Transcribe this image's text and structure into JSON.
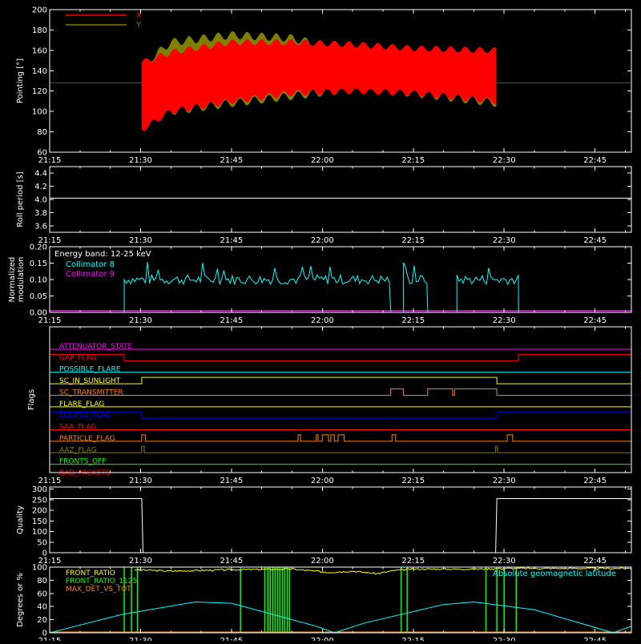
{
  "chart_data": [
    {
      "type": "line",
      "id": "pointing",
      "ylabel": "Pointing [°]",
      "yticks": [
        60,
        80,
        100,
        120,
        140,
        160,
        180,
        200
      ],
      "ylim": [
        60,
        200
      ],
      "xticks": [
        "21:15",
        "21:30",
        "21:45",
        "22:00",
        "22:15",
        "22:30",
        "22:45"
      ],
      "x_range_minutes": [
        0,
        96
      ],
      "legend": "top-left",
      "series": [
        {
          "name": "X",
          "color": "#ff0000",
          "baseline": 128,
          "active": [
            15.2,
            73.8
          ],
          "upper": [
            [
              15.2,
              148
            ],
            [
              20,
              158
            ],
            [
              30,
              168
            ],
            [
              40,
              168
            ],
            [
              50,
              166
            ],
            [
              60,
              162
            ],
            [
              73.8,
              160
            ]
          ],
          "lower": [
            [
              15.2,
              82
            ],
            [
              20,
              100
            ],
            [
              30,
              110
            ],
            [
              40,
              118
            ],
            [
              50,
              120
            ],
            [
              60,
              118
            ],
            [
              73.8,
              110
            ]
          ]
        },
        {
          "name": "Y",
          "color": "#808000",
          "baseline": 128,
          "active": [
            15.2,
            73.8
          ],
          "upper": [
            [
              15.2,
              145
            ],
            [
              20,
              168
            ],
            [
              30,
              175
            ],
            [
              40,
              172
            ],
            [
              50,
              158
            ],
            [
              60,
              155
            ],
            [
              73.8,
              152
            ]
          ],
          "lower": [
            [
              15.2,
              92
            ],
            [
              20,
              100
            ],
            [
              30,
              108
            ],
            [
              40,
              115
            ],
            [
              50,
              122
            ],
            [
              60,
              118
            ],
            [
              73.8,
              108
            ]
          ]
        }
      ]
    },
    {
      "type": "line",
      "id": "roll",
      "ylabel": "Roll period [s]",
      "yticks": [
        3.6,
        3.8,
        4.0,
        4.2,
        4.4
      ],
      "ylim": [
        3.5,
        4.5
      ],
      "xticks": [
        "21:15",
        "21:30",
        "21:45",
        "22:00",
        "22:15",
        "22:30",
        "22:45"
      ],
      "series": [
        {
          "name": "",
          "color": "#ffffff",
          "values": [
            [
              0,
              4.02
            ],
            [
              96,
              4.02
            ]
          ]
        }
      ]
    },
    {
      "type": "line",
      "id": "modulation",
      "ylabel": "Normalized modulation",
      "yticks": [
        0.0,
        0.05,
        0.1,
        0.15,
        0.2
      ],
      "ylim": [
        0,
        0.2
      ],
      "xticks": [
        "21:15",
        "21:30",
        "21:45",
        "22:00",
        "22:15",
        "22:30",
        "22:45"
      ],
      "annotation": "Energy band: 12-25 keV",
      "legend": "top-left",
      "series": [
        {
          "name": "Collimator 8",
          "color": "#00ffff",
          "segments": [
            [
              12.3,
              56.3
            ],
            [
              58.4,
              62.4
            ],
            [
              67.2,
              77.4
            ]
          ],
          "level": 0.1
        },
        {
          "name": "Collimator 9",
          "color": "#ff00ff",
          "values": [
            [
              0,
              0.005
            ],
            [
              96,
              0.005
            ]
          ]
        }
      ]
    },
    {
      "type": "line",
      "id": "flags",
      "ylabel": "Flags",
      "xticks": [
        "21:15",
        "21:30",
        "21:45",
        "22:00",
        "22:15",
        "22:30",
        "22:45"
      ],
      "series": [
        {
          "name": "ATTENUATOR_STATE",
          "color": "#ff00ff",
          "pulses": []
        },
        {
          "name": "GAP_FLAG",
          "color": "#ff0000",
          "pulses": [
            [
              0,
              12.3
            ],
            [
              77.4,
              96
            ]
          ]
        },
        {
          "name": "POSSIBLE_FLARE",
          "color": "#00ffff",
          "pulses": []
        },
        {
          "name": "SC_IN_SUNLIGHT",
          "color": "#ffff00",
          "pulses": [
            [
              15.2,
              73.8
            ]
          ]
        },
        {
          "name": "SC_TRANSMITTER",
          "color": "#ff8000",
          "pulses": [
            [
              56.3,
              58.4
            ],
            [
              62.4,
              66.5
            ],
            [
              66.8,
              73.8
            ]
          ]
        },
        {
          "name": "FLARE_FLAG",
          "color": "#ffff00",
          "pulses": []
        },
        {
          "name": "ECLIPSE_FLAG",
          "color": "#0000ff",
          "pulses": [
            [
              0,
              15.2
            ],
            [
              73.8,
              96
            ]
          ]
        },
        {
          "name": "SAA_FLAG",
          "color": "#ff0000",
          "pulses": []
        },
        {
          "name": "PARTICLE_FLAG",
          "color": "#ff8000",
          "pulses": [
            [
              15.2,
              15.8
            ],
            [
              41.0,
              41.4
            ],
            [
              44.0,
              44.3
            ],
            [
              45.0,
              46.0
            ],
            [
              46.4,
              47.0
            ],
            [
              47.6,
              48.6
            ],
            [
              56.5,
              57.1
            ],
            [
              75.5,
              76.4
            ]
          ]
        },
        {
          "name": "AAZ_FLAG",
          "color": "#808000",
          "pulses": [
            [
              15.2,
              15.6
            ],
            [
              73.6,
              73.9
            ]
          ]
        },
        {
          "name": "FRONTS_OFF",
          "color": "#00ff00",
          "pulses": []
        },
        {
          "name": "BAD_PACKETS",
          "color": "#ff0000",
          "pulses": []
        }
      ]
    },
    {
      "type": "line",
      "id": "quality",
      "ylabel": "Quality",
      "yticks": [
        0,
        50,
        100,
        150,
        200,
        250,
        300
      ],
      "ylim": [
        0,
        310
      ],
      "xticks": [
        "21:15",
        "21:30",
        "21:45",
        "22:00",
        "22:15",
        "22:30",
        "22:45"
      ],
      "series": [
        {
          "name": "",
          "color": "#ffffff",
          "values": [
            [
              0,
              255
            ],
            [
              15.2,
              255
            ],
            [
              15.4,
              0
            ],
            [
              73.6,
              0
            ],
            [
              73.8,
              255
            ],
            [
              96,
              255
            ]
          ]
        }
      ]
    },
    {
      "type": "line",
      "id": "ratios",
      "ylabel": "Degrees or %",
      "yticks": [
        0,
        20,
        40,
        60,
        80,
        100
      ],
      "ylim": [
        0,
        100
      ],
      "xticks": [
        "21:15",
        "21:30",
        "21:45",
        "22:00",
        "22:15",
        "22:30",
        "22:45"
      ],
      "legend": "top-left",
      "right_label": "Absolute geomagnetic latitude",
      "right_label_color": "#00ffff",
      "series": [
        {
          "name": "FRONT_RATIO",
          "color": "#ffff00",
          "values": [
            [
              14,
              96
            ],
            [
              20,
              94
            ],
            [
              30,
              96
            ],
            [
              40,
              97
            ],
            [
              46,
              92
            ],
            [
              50,
              94
            ],
            [
              54,
              90
            ],
            [
              57,
              95
            ],
            [
              60,
              97
            ],
            [
              70,
              97
            ],
            [
              75,
              98
            ],
            [
              96,
              98
            ]
          ]
        },
        {
          "name": "FRONT_RATIO_1125",
          "color": "#00ff00",
          "spikes": [
            12.3,
            13.5,
            14.5,
            31.5,
            35.5,
            36.0,
            36.4,
            36.8,
            37.2,
            37.6,
            38.0,
            38.4,
            38.8,
            39.2,
            39.6,
            58.0,
            59.0,
            72.0,
            73.8,
            75.0,
            77.0
          ]
        },
        {
          "name": "MAX_DET_VS_TOT",
          "color": "#ff8000",
          "values": [
            [
              0,
              1
            ],
            [
              96,
              1
            ]
          ]
        },
        {
          "name": "",
          "color": "#00ffff",
          "values": [
            [
              0,
              0
            ],
            [
              12,
              28
            ],
            [
              24,
              47
            ],
            [
              30,
              45
            ],
            [
              44,
              10
            ],
            [
              47,
              0
            ],
            [
              52,
              15
            ],
            [
              65,
              43
            ],
            [
              70,
              47
            ],
            [
              80,
              35
            ],
            [
              93,
              0
            ],
            [
              96,
              10
            ]
          ]
        }
      ]
    }
  ]
}
